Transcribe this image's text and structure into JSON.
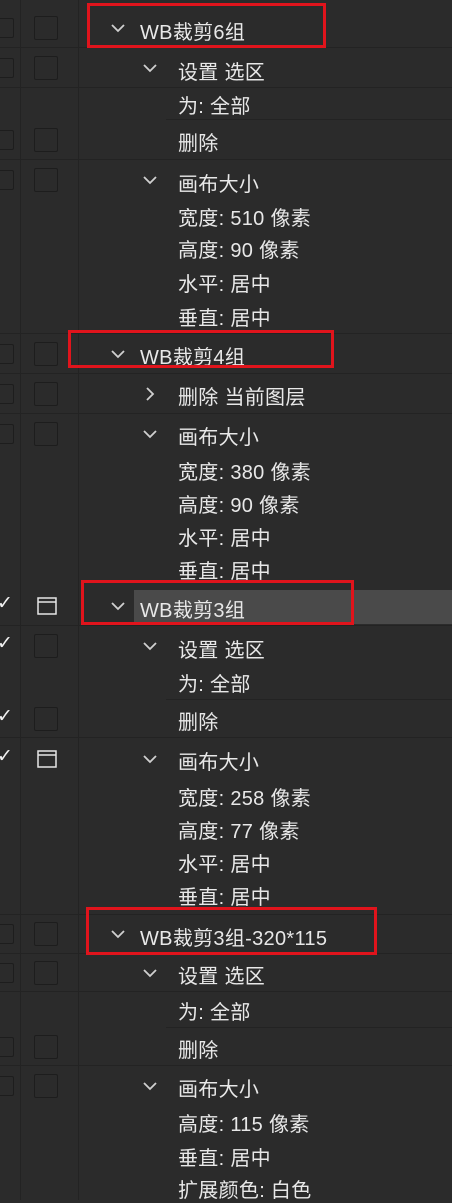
{
  "actions_panel": {
    "groups": [
      {
        "title": "WB裁剪6组",
        "items": [
          {
            "label": "设置 选区",
            "expanded": true
          },
          {
            "label": "为: 全部"
          },
          {
            "label": "删除"
          },
          {
            "label": "画布大小",
            "expanded": true
          },
          {
            "label": "宽度: 510 像素"
          },
          {
            "label": "高度: 90 像素"
          },
          {
            "label": "水平: 居中"
          },
          {
            "label": "垂直: 居中"
          }
        ]
      },
      {
        "title": "WB裁剪4组",
        "items": [
          {
            "label": "删除 当前图层",
            "expanded": false
          },
          {
            "label": "画布大小",
            "expanded": true
          },
          {
            "label": "宽度: 380 像素"
          },
          {
            "label": "高度: 90 像素"
          },
          {
            "label": "水平: 居中"
          },
          {
            "label": "垂直: 居中"
          }
        ]
      },
      {
        "title": "WB裁剪3组",
        "selected": true,
        "items": [
          {
            "label": "设置 选区",
            "expanded": true
          },
          {
            "label": "为: 全部"
          },
          {
            "label": "删除"
          },
          {
            "label": "画布大小",
            "expanded": true
          },
          {
            "label": "宽度: 258 像素"
          },
          {
            "label": "高度: 77 像素"
          },
          {
            "label": "水平: 居中"
          },
          {
            "label": "垂直: 居中"
          }
        ]
      },
      {
        "title": "WB裁剪3组-320*115",
        "items": [
          {
            "label": "设置 选区",
            "expanded": true
          },
          {
            "label": "为: 全部"
          },
          {
            "label": "删除"
          },
          {
            "label": "画布大小",
            "expanded": true
          },
          {
            "label": "高度: 115 像素"
          },
          {
            "label": "垂直: 居中"
          },
          {
            "label": "扩展颜色: 白色"
          }
        ]
      }
    ]
  },
  "highlight_color": "#e0141c",
  "icons": {
    "expanded": "chevron-down-icon",
    "collapsed": "chevron-right-icon",
    "checkmark": "checkmark-icon",
    "dialog": "dialog-toggle-icon"
  }
}
